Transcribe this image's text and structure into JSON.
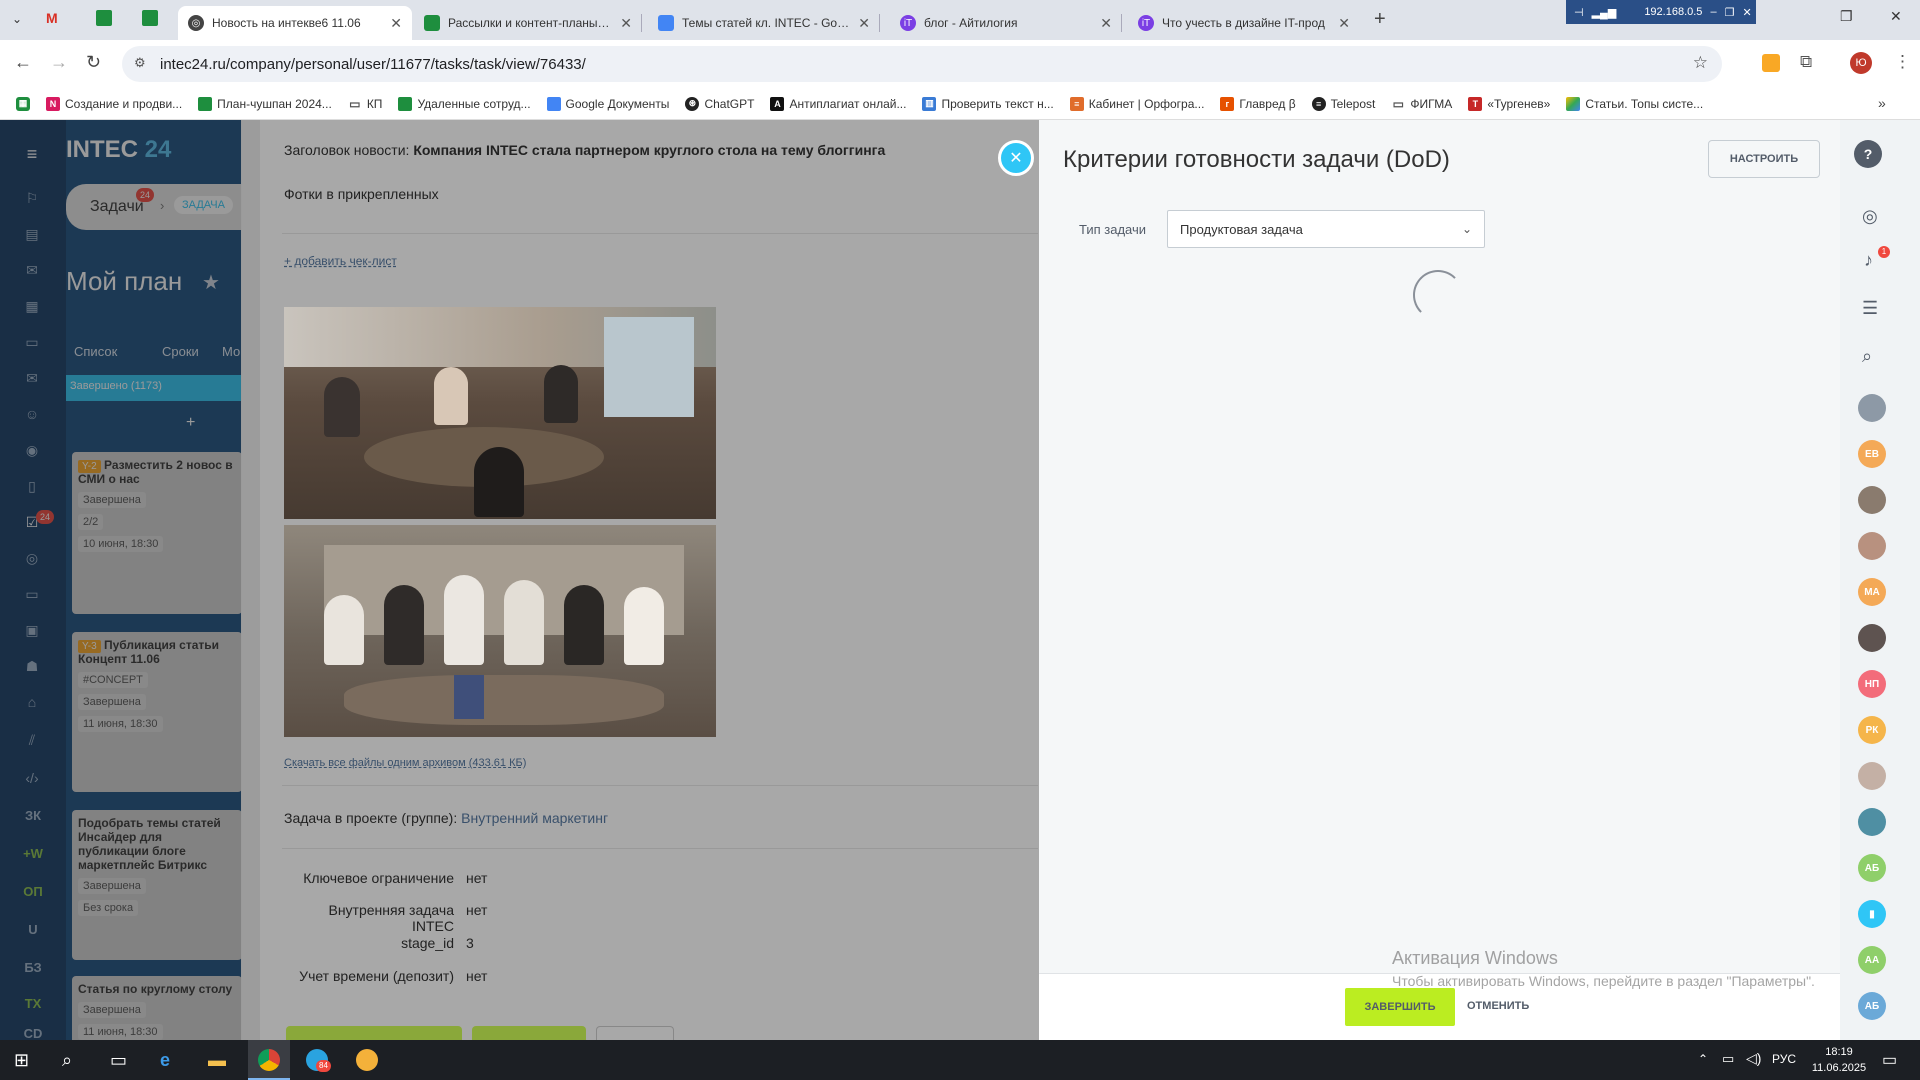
{
  "browser": {
    "tabs": [
      {
        "title": "Новость на интекве6 11.06",
        "icon": "globe-icon",
        "color": "#444444",
        "active": true
      },
      {
        "title": "Рассылки и контент-планы (Ма",
        "icon": "sheets-icon",
        "color": "#1e8e3e"
      },
      {
        "title": "Темы статей кл. INTEC - Goog",
        "icon": "docs-icon",
        "color": "#4285f4"
      },
      {
        "title": "блог - Айтилогия",
        "icon": "it-logo-icon",
        "color": "#7b3fe4"
      },
      {
        "title": "Что учесть в дизайне IT-прод",
        "icon": "it-logo-icon",
        "color": "#7b3fe4"
      }
    ],
    "network_label": "192.168.0.5",
    "url": "intec24.ru/company/personal/user/11677/tasks/task/view/76433/",
    "bookmarks": [
      {
        "label": "Создание и продви...",
        "icon": "n-icon",
        "color": "#d81b60"
      },
      {
        "label": "План-чушпан 2024...",
        "icon": "sheets-icon",
        "color": "#1e8e3e"
      },
      {
        "label": "КП",
        "icon": "folder-icon",
        "color": "#555555"
      },
      {
        "label": "Удаленные сотруд...",
        "icon": "sheets-icon",
        "color": "#1e8e3e"
      },
      {
        "label": "Google Документы",
        "icon": "docs-icon",
        "color": "#4285f4"
      },
      {
        "label": "ChatGPT",
        "icon": "openai-icon",
        "color": "#222222"
      },
      {
        "label": "Антиплагиат онлай...",
        "icon": "a-icon",
        "color": "#111111"
      },
      {
        "label": "Проверить текст н...",
        "icon": "book-icon",
        "color": "#3a7bd5"
      },
      {
        "label": "Кабинет | Орфогра...",
        "icon": "lines-icon",
        "color": "#e06c2b"
      },
      {
        "label": "Главред β",
        "icon": "glavred-icon",
        "color": "#e65100"
      },
      {
        "label": "Telepost",
        "icon": "telepost-icon",
        "color": "#222222"
      },
      {
        "label": "ФИГМА",
        "icon": "folder-icon",
        "color": "#555555"
      },
      {
        "label": "«Тургенев»",
        "icon": "t-icon",
        "color": "#c62828"
      },
      {
        "label": "Статьи. Топы систе...",
        "icon": "drive-icon",
        "color": "#fbbc04"
      }
    ]
  },
  "app": {
    "logo_text": "INTEC",
    "logo_num": "24",
    "breadcrumb_tasks": "Задачи",
    "breadcrumb_count": "24",
    "breadcrumb_task": "ЗАДАЧА",
    "plan_title": "Мой план",
    "views": [
      "Список",
      "Сроки",
      "Мо"
    ],
    "done_header": "Завершено",
    "done_count": "(1173)",
    "add_symbol": "+",
    "sidebar_badge": "24",
    "sidebar_text_items": [
      "ЗК",
      "+W",
      "ОП",
      "U",
      "БЗ",
      "ТХ",
      "CD"
    ],
    "cards": [
      {
        "tag": "Y-2",
        "title": "Разместить 2 новос в СМИ о нас",
        "status": "Завершена",
        "check": "2/2",
        "date": "10 июня, 18:30"
      },
      {
        "tag": "Y-3",
        "title": "Публикация статьи Концепт 11.06",
        "hashtag": "#CONCEPT",
        "status": "Завершена",
        "date": "11 июня, 18:30"
      },
      {
        "title": "Подобрать темы статей Инсайдер для публикации блоге маркетплейс Битрикс",
        "status": "Завершена",
        "date": "Без срока"
      },
      {
        "title": "Статья по круглому столу",
        "status": "Завершена",
        "date": "11 июня, 18:30"
      }
    ]
  },
  "task": {
    "news_label": "Заголовок новости:",
    "news_value": "Компания INTEC стала партнером круглого стола на тему блоггинга",
    "photos_text": "Фотки в прикрепленных",
    "add_checklist": "+ добавить чек-лист",
    "download_all": "Скачать все файлы одним архивом (433.61 КБ)",
    "project_label": "Задача в проекте (группе):",
    "project_value": "Внутренний маркетинг",
    "fields": [
      {
        "label": "Ключевое ограничение",
        "value": "нет"
      },
      {
        "label": "Внутренняя задача INTEC",
        "value": "нет"
      },
      {
        "label": "stage_id",
        "value": "3"
      },
      {
        "label": "Учет времени (депозит)",
        "value": "нет"
      }
    ]
  },
  "dod": {
    "title": "Критерии готовности задачи (DoD)",
    "configure_button": "НАСТРОИТЬ",
    "type_label": "Тип задачи",
    "type_value": "Продуктовая задача",
    "finish_button": "ЗАВЕРШИТЬ",
    "cancel_button": "ОТМЕНИТЬ",
    "accent": "#bbed21"
  },
  "rail": {
    "notification_count": "1",
    "avatars": [
      "ЕВ",
      "МА",
      "НП",
      "РК",
      "АБ",
      "АА",
      "АБ"
    ]
  },
  "windows": {
    "activation_title": "Активация Windows",
    "activation_text": "Чтобы активировать Windows, перейдите в раздел \"Параметры\".",
    "lang": "РУС",
    "time": "18:19",
    "date": "11.06.2025",
    "telegram_badge": "84"
  }
}
